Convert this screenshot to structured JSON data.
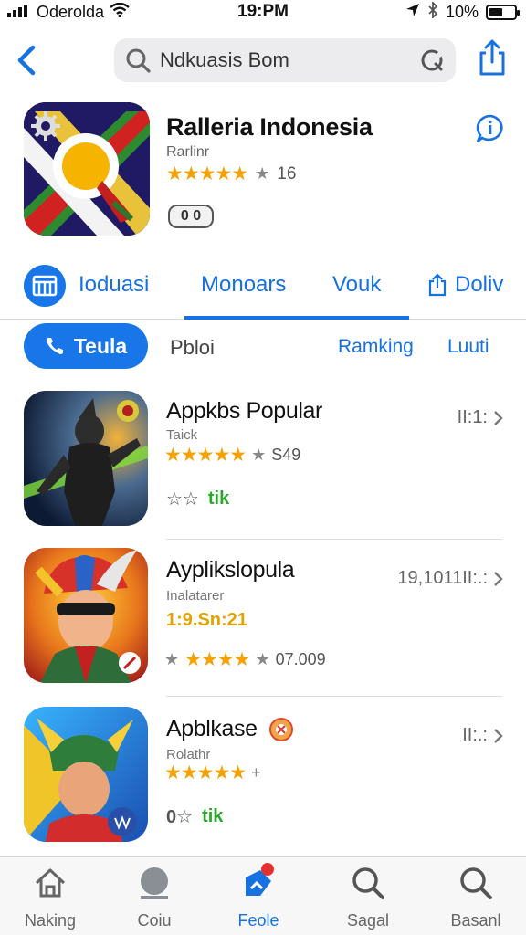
{
  "status_bar": {
    "carrier": "Oderolda",
    "time": "19:PM",
    "battery": "10%"
  },
  "search": {
    "placeholder": "Ndkuasis Bom"
  },
  "app": {
    "title": "Ralleria Indonesia",
    "subtitle": "Rarlinr",
    "rating_count": "16",
    "badge": "0 0"
  },
  "tabs": [
    "Ioduasi",
    "Monoars",
    "Vouk",
    "Doliv"
  ],
  "filters": {
    "active": "Teula",
    "plain": "Pbloi",
    "ranking": "Ramking",
    "last": "Luuti"
  },
  "list": [
    {
      "title": "Appkbs Popular",
      "subtitle": "Taick",
      "rating_count": "S49",
      "tag": "tik",
      "right": "II:1:"
    },
    {
      "title": "Ayplikslopula",
      "subtitle": "Inalatarer",
      "price": "1:9.Sn:21",
      "rating_count": "07.009",
      "right": "19,1011II:.:"
    },
    {
      "title": "Apblkase",
      "subtitle": "Rolathr",
      "tag": "tik",
      "right": "II:.:"
    }
  ],
  "tabbar": [
    {
      "label": "Naking",
      "icon": "home-icon"
    },
    {
      "label": "Coiu",
      "icon": "profile-icon"
    },
    {
      "label": "Feole",
      "icon": "apps-icon"
    },
    {
      "label": "Sagal",
      "icon": "search-icon"
    },
    {
      "label": "Basanl",
      "icon": "search-icon"
    }
  ],
  "colors": {
    "accent": "#1672e0",
    "star": "#f5a100",
    "green_tag": "#2aa82a"
  }
}
